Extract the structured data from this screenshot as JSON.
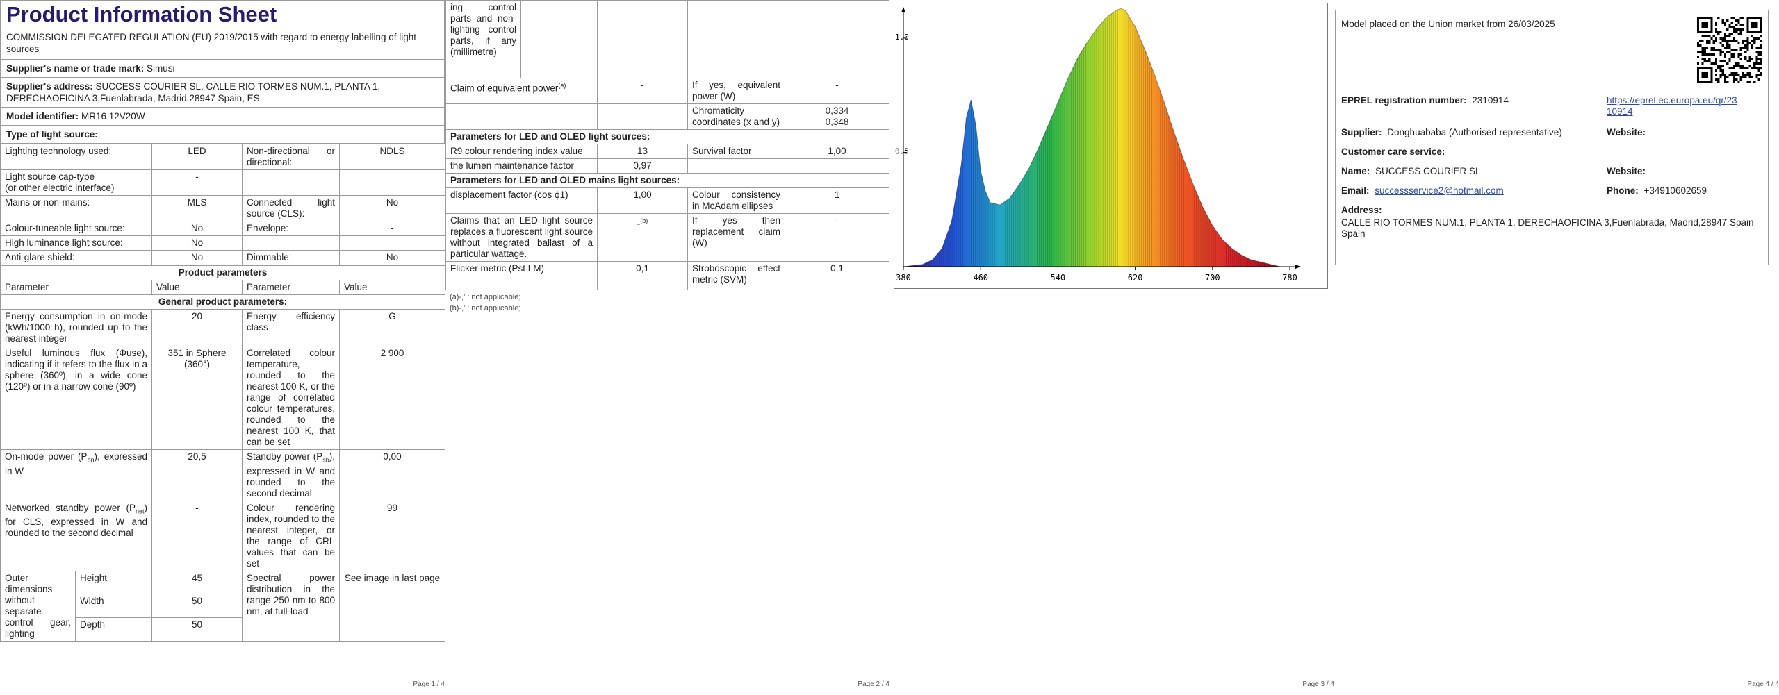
{
  "pages": [
    "Page 1 / 4",
    "Page 2 / 4",
    "Page 3 / 4",
    "Page 4 / 4"
  ],
  "p1": {
    "title": "Product Information Sheet",
    "regulation": "COMMISSION DELEGATED REGULATION (EU) 2019/2015 with regard to energy labelling of light sources",
    "supplier_label": "Supplier's name or trade mark:",
    "supplier_value": "Simusi",
    "address_label": "Supplier's address:",
    "address_value": "SUCCESS COURIER SL, CALLE RIO TORMES NUM.1, PLANTA 1, DERECHAOFICINA 3,Fuenlabrada, Madrid,28947 Spain, ES",
    "model_label": "Model identifier:",
    "model_value": "MR16 12V20W",
    "type_label": "Type of light source:",
    "lt_used": "Lighting technology used:",
    "lt_used_v": "LED",
    "nondir": "Non-directional or directional:",
    "nondir_v": "NDLS",
    "cap": "Light source cap-type",
    "cap2": "(or other electric interface)",
    "cap_v": "-",
    "mains": "Mains or non-mains:",
    "mains_v": "MLS",
    "cls": "Connected light source (CLS):",
    "cls_v": "No",
    "tunable": "Colour-tuneable light source:",
    "tunable_v": "No",
    "envelope": "Envelope:",
    "envelope_v": "-",
    "hl": "High luminance light source:",
    "hl_v": "No",
    "glare": "Anti-glare shield:",
    "glare_v": "No",
    "dim": "Dimmable:",
    "dim_v": "No",
    "prod_params": "Product parameters",
    "h_param": "Parameter",
    "h_value": "Value",
    "h_param2": "Parameter",
    "h_value2": "Value",
    "general": "General product parameters:",
    "energy": "Energy consumption in on-mode (kWh/1000 h), rounded up to the nearest integer",
    "energy_v": "20",
    "eclass": "Energy efficiency class",
    "eclass_v": "G",
    "flux": "Useful luminous flux (Φuse), indicating if it refers to the flux in a sphere (360º), in a wide cone (120º) or in a narrow cone (90º)",
    "flux_v": "351 in Sphere (360°)",
    "cct": "Correlated colour temperature, rounded to the nearest 100 K, or the range of correlated colour temperatures, rounded to the nearest 100 K, that can be set",
    "cct_v": "2 900",
    "pon": "On-mode power (P",
    "pon_sub": "on",
    "pon2": "), expressed in W",
    "pon_v": "20,5",
    "psb": "Standby power (P",
    "psb_sub": "sb",
    "psb2": "), expressed in W and rounded to the second decimal",
    "psb_v": "0,00",
    "pnet": "Networked standby power (P",
    "pnet_sub": "net",
    "pnet2": ") for CLS, expressed in W and rounded to the second decimal",
    "pnet_v": "-",
    "cri": "Colour rendering index, rounded to the nearest integer, or the range of CRI-values that can be set",
    "cri_v": "99",
    "outer": "Outer dimensions without separate control gear, lighting",
    "height": "Height",
    "height_v": "45",
    "width": "Width",
    "width_v": "50",
    "depth": "Depth",
    "depth_v": "50",
    "spd": "Spectral power distribution in the range 250 nm to 800 nm, at full-load",
    "spd_v": "See image in last page"
  },
  "p2": {
    "cont": "ing control parts and non-lighting control parts, if any (millimetre)",
    "claim": "Claim of equivalent power",
    "claim_sup": "(a)",
    "claim_v": "-",
    "ifyes": "If yes, equivalent power (W)",
    "ifyes_v": "-",
    "chroma": "Chromaticity coordinates (x and y)",
    "chroma_x": "0,334",
    "chroma_y": "0,348",
    "led_sec": "Parameters for LED and OLED light sources:",
    "r9": "R9 colour rendering index value",
    "r9_v": "13",
    "survival": "Survival factor",
    "survival_v": "1,00",
    "lumen": "the lumen maintenance factor",
    "lumen_v": "0,97",
    "mains_sec": "Parameters for LED and OLED mains light sources:",
    "disp": "displacement factor (cos ϕ1)",
    "disp_v": "1,00",
    "mcadam": "Colour consistency in McAdam ellipses",
    "mcadam_v": "1",
    "claims": "Claims that an LED light source replaces a fluorescent light source without integrated ballast of a particular wattage.",
    "claims_v": "-",
    "claims_sup": "(b)",
    "replace": "If yes then replacement claim (W)",
    "replace_v": "-",
    "flicker": "Flicker metric (Pst LM)",
    "flicker_v": "0,1",
    "svm": "Stroboscopic effect metric (SVM)",
    "svm_v": "0,1",
    "fn_a": "(a)-,' : not applicable;",
    "fn_b": "(b)-,' : not applicable;"
  },
  "chart_data": {
    "type": "area",
    "title": "",
    "xlabel": "",
    "ylabel": "",
    "x_ticks": [
      "380",
      "460",
      "540",
      "620",
      "700",
      "780"
    ],
    "y_ticks": [
      "0.5",
      "1.0"
    ],
    "xlim": [
      380,
      780
    ],
    "ylim": [
      0,
      1.1
    ],
    "x": [
      380,
      400,
      410,
      420,
      430,
      440,
      445,
      450,
      455,
      460,
      465,
      470,
      480,
      490,
      500,
      510,
      520,
      530,
      540,
      550,
      560,
      570,
      580,
      590,
      600,
      605,
      610,
      620,
      630,
      640,
      650,
      660,
      670,
      680,
      690,
      700,
      710,
      720,
      730,
      740,
      750,
      760,
      770,
      780
    ],
    "values": [
      0.0,
      0.01,
      0.03,
      0.08,
      0.2,
      0.45,
      0.65,
      0.73,
      0.62,
      0.42,
      0.33,
      0.28,
      0.27,
      0.3,
      0.36,
      0.43,
      0.52,
      0.62,
      0.72,
      0.82,
      0.91,
      0.98,
      1.04,
      1.09,
      1.12,
      1.13,
      1.12,
      1.05,
      0.95,
      0.84,
      0.72,
      0.59,
      0.47,
      0.36,
      0.26,
      0.18,
      0.12,
      0.08,
      0.05,
      0.03,
      0.02,
      0.01,
      0.0,
      0.0
    ]
  },
  "p4": {
    "placed": "Model placed on the Union market from 26/03/2025",
    "eprel_label": "EPREL registration number:",
    "eprel_v": "2310914",
    "eprel_link1": "https://eprel.ec.europa.eu/qr/23",
    "eprel_link2": "10914",
    "supplier_label": "Supplier:",
    "supplier_v": "Donghuababa (Authorised representative)",
    "website_label": "Website:",
    "care": "Customer care service:",
    "name_label": "Name:",
    "name_v": "SUCCESS COURIER SL",
    "website2_label": "Website:",
    "email_label": "Email:",
    "email_v": "successservice2@hotmail.com",
    "phone_label": "Phone:",
    "phone_v": "+34910602659",
    "address_label": "Address:",
    "address_v": "CALLE RIO TORMES NUM.1, PLANTA 1, DERECHAOFICINA 3,Fuenlabrada, Madrid,28947 Spain Spain"
  }
}
